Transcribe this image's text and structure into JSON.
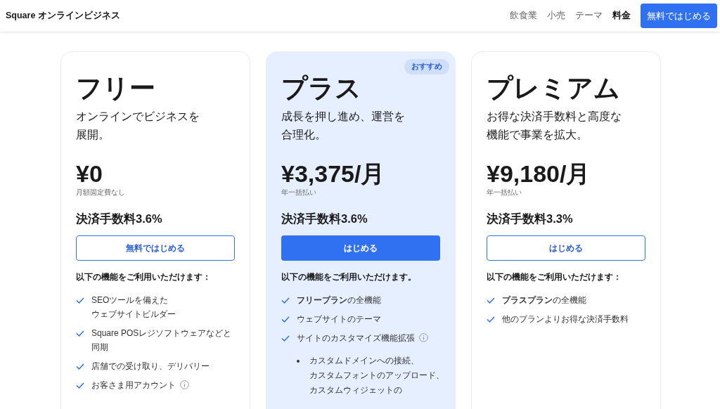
{
  "header": {
    "brand": "Square オンラインビジネス",
    "nav": [
      {
        "label": "飲食業",
        "selected": false
      },
      {
        "label": "小売",
        "selected": false
      },
      {
        "label": "テーマ",
        "selected": false
      },
      {
        "label": "料金",
        "selected": true
      }
    ],
    "cta": "無料ではじめる"
  },
  "plans": [
    {
      "name": "フリー",
      "highlighted": false,
      "description": [
        "オンラインでビジネスを",
        "展開。"
      ],
      "price": "¥0",
      "price_note": "月額固定費なし",
      "fee": "決済手数料3.6%",
      "button": {
        "label": "無料ではじめる",
        "kind": "outline"
      },
      "lead": "以下の機能をご利用いただけます：",
      "features": [
        {
          "lines": [
            "SEOツールを備えた",
            "ウェブサイトビルダー"
          ],
          "info": false
        },
        {
          "lines": [
            "Square POSレジソフトウェアなどと",
            "同期"
          ],
          "info": false
        },
        {
          "lines": [
            "店舗での受け取り、デリバリー"
          ],
          "info": false
        },
        {
          "lines": [
            "お客さま用アカウント"
          ],
          "info": true
        }
      ]
    },
    {
      "name": "プラス",
      "highlighted": true,
      "badge": "おすすめ",
      "description": [
        "成長を押し進め、運営を",
        "合理化。"
      ],
      "price": "¥3,375/月",
      "price_note": "年一括払い",
      "fee": "決済手数料3.6%",
      "button": {
        "label": "はじめる",
        "kind": "filled"
      },
      "lead": "以下の機能をご利用いただけます。",
      "features": [
        {
          "lines": [
            "**フリープラン**の全機能"
          ],
          "info": false
        },
        {
          "lines": [
            "ウェブサイトのテーマ"
          ],
          "info": false
        },
        {
          "lines": [
            "サイトのカスタマイズ機能拡張"
          ],
          "info": true
        }
      ],
      "sub_items": [
        [
          "カスタムドメインへの接続、",
          "カスタムフォントのアップロード、",
          "カスタムウィジェットの"
        ]
      ]
    },
    {
      "name": "プレミアム",
      "highlighted": false,
      "description": [
        "お得な決済手数料と高度な",
        "機能で事業を拡大。"
      ],
      "price": "¥9,180/月",
      "price_note": "年一括払い",
      "fee": "決済手数料3.3%",
      "button": {
        "label": "はじめる",
        "kind": "outline"
      },
      "lead": "以下の機能をご利用いただけます：",
      "features": [
        {
          "lines": [
            "**プラスプラン**の全機能"
          ],
          "info": false
        },
        {
          "lines": [
            "他のプランよりお得な決済手数料"
          ],
          "info": false
        }
      ]
    }
  ]
}
